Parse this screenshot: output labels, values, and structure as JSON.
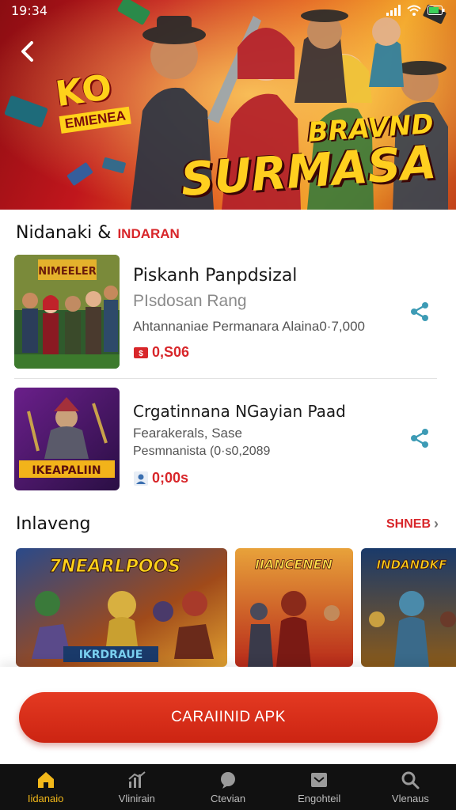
{
  "status_bar": {
    "time": "19:34"
  },
  "hero": {
    "badge_big": "KO",
    "badge_small": "EMIENEA",
    "title_line1": "BRAVND",
    "title_line2": "SURMASA"
  },
  "section1": {
    "title": "Nidanaki &",
    "accent": "INDARAN",
    "items": [
      {
        "title": "Piskanh Panpdsizal",
        "subtitle": "PIsdosan Rang",
        "meta": "Ahtannaniae Permanara Alaina0·7,000",
        "price": "0,S06",
        "thumb_text": "NIMEELER"
      },
      {
        "title": "Crgatinnana NGayian Paad",
        "subtitle": "Fearakerals, Sase",
        "meta": "Pesmnanista (0·s0,2089",
        "price": "0;00s",
        "thumb_text": "IKEAPALIIN"
      }
    ]
  },
  "section2": {
    "title": "Inlaveng",
    "see_all": "SHNEB",
    "cards": [
      {
        "title": "7NEARLPOOS",
        "sub": "IKRDRAUE"
      },
      {
        "title": "IIANCENEN"
      },
      {
        "title": "INDANDKF"
      }
    ]
  },
  "cta": {
    "label": "CARAIINID APK"
  },
  "nav": [
    {
      "label": "Iidanaio",
      "icon": "home-icon"
    },
    {
      "label": "Vlinirain",
      "icon": "chart-icon"
    },
    {
      "label": "Ctevian",
      "icon": "chat-icon"
    },
    {
      "label": "Engohteil",
      "icon": "inbox-icon"
    },
    {
      "label": "Vlenaus",
      "icon": "search-icon"
    }
  ],
  "colors": {
    "accent": "#d8262a",
    "cta": "#d42c17",
    "nav_bg": "#111111",
    "nav_active": "#f2b81a",
    "share": "#3d9bb5"
  }
}
